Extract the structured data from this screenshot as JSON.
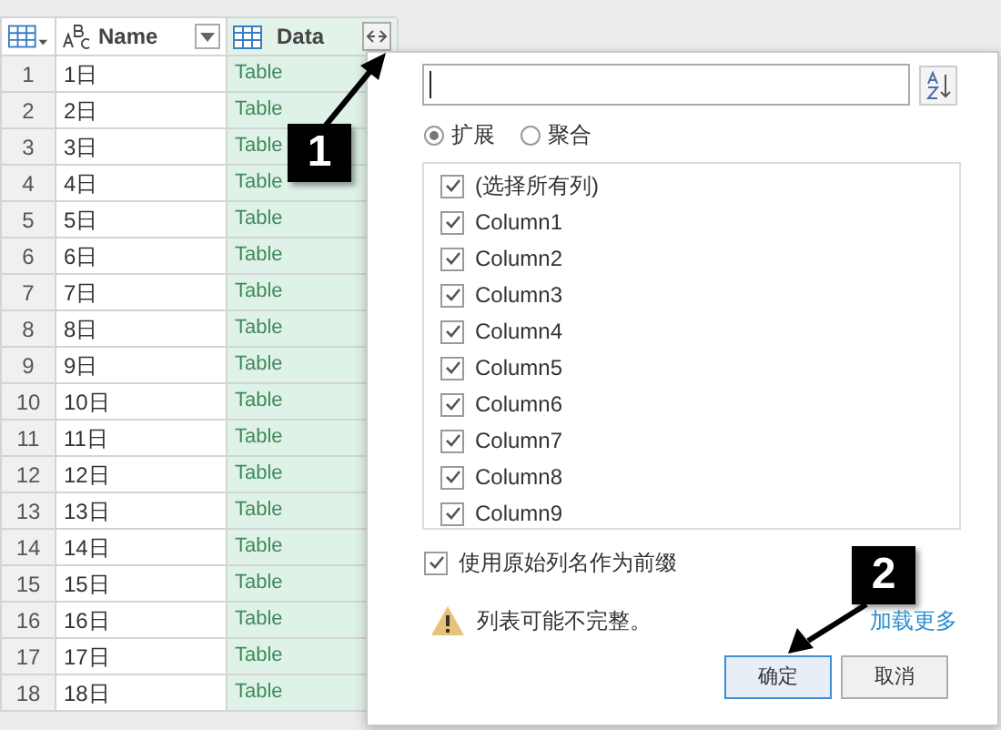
{
  "table": {
    "columns": [
      {
        "kind": "index"
      },
      {
        "kind": "text",
        "label": "Name"
      },
      {
        "kind": "table",
        "label": "Data"
      }
    ],
    "rows": [
      {
        "index": "1",
        "name": "1日",
        "data": "Table"
      },
      {
        "index": "2",
        "name": "2日",
        "data": "Table"
      },
      {
        "index": "3",
        "name": "3日",
        "data": "Table"
      },
      {
        "index": "4",
        "name": "4日",
        "data": "Table"
      },
      {
        "index": "5",
        "name": "5日",
        "data": "Table"
      },
      {
        "index": "6",
        "name": "6日",
        "data": "Table"
      },
      {
        "index": "7",
        "name": "7日",
        "data": "Table"
      },
      {
        "index": "8",
        "name": "8日",
        "data": "Table"
      },
      {
        "index": "9",
        "name": "9日",
        "data": "Table"
      },
      {
        "index": "10",
        "name": "10日",
        "data": "Table"
      },
      {
        "index": "11",
        "name": "11日",
        "data": "Table"
      },
      {
        "index": "12",
        "name": "12日",
        "data": "Table"
      },
      {
        "index": "13",
        "name": "13日",
        "data": "Table"
      },
      {
        "index": "14",
        "name": "14日",
        "data": "Table"
      },
      {
        "index": "15",
        "name": "15日",
        "data": "Table"
      },
      {
        "index": "16",
        "name": "16日",
        "data": "Table"
      },
      {
        "index": "17",
        "name": "17日",
        "data": "Table"
      },
      {
        "index": "18",
        "name": "18日",
        "data": "Table"
      }
    ]
  },
  "dialog": {
    "modes": [
      {
        "label": "扩展",
        "selected": true
      },
      {
        "label": "聚合",
        "selected": false
      }
    ],
    "column_list": [
      {
        "label": "(选择所有列)",
        "checked": true
      },
      {
        "label": "Column1",
        "checked": true
      },
      {
        "label": "Column2",
        "checked": true
      },
      {
        "label": "Column3",
        "checked": true
      },
      {
        "label": "Column4",
        "checked": true
      },
      {
        "label": "Column5",
        "checked": true
      },
      {
        "label": "Column6",
        "checked": true
      },
      {
        "label": "Column7",
        "checked": true
      },
      {
        "label": "Column8",
        "checked": true
      },
      {
        "label": "Column9",
        "checked": true
      }
    ],
    "prefix_option": {
      "label": "使用原始列名作为前缀",
      "checked": true
    },
    "warning": "列表可能不完整。",
    "load_more": "加载更多",
    "buttons": [
      {
        "label": "确定",
        "default": true
      },
      {
        "label": "取消",
        "default": false
      }
    ]
  },
  "callouts": [
    {
      "label": "1"
    },
    {
      "label": "2"
    }
  ]
}
